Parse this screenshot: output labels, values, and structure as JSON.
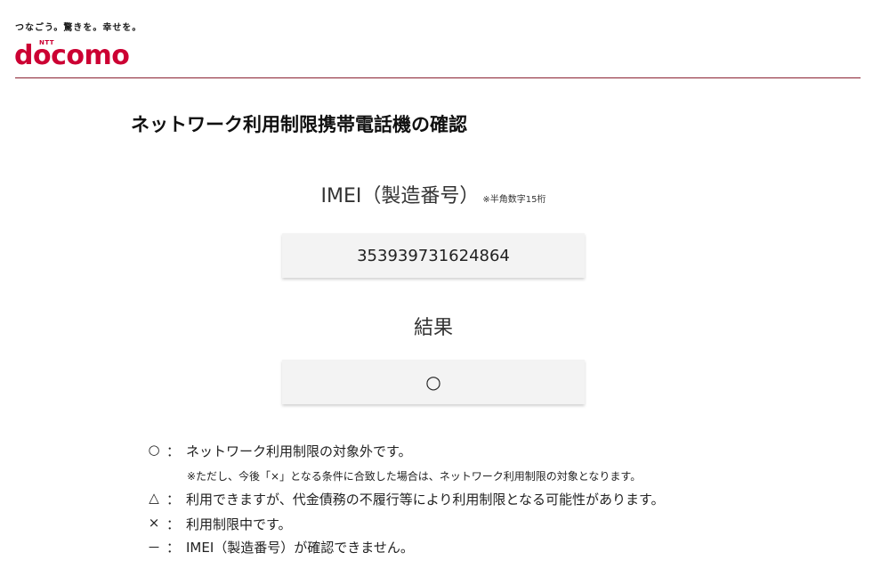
{
  "header": {
    "tagline": "つなごう。驚きを。幸せを。",
    "logo_ntt": "NTT",
    "logo_word": "docomo"
  },
  "page_title": "ネットワーク利用制限携帯電話機の確認",
  "imei": {
    "label": "IMEI（製造番号）",
    "note": "※半角数字15桁",
    "value": "353939731624864"
  },
  "result": {
    "label": "結果",
    "value": "○"
  },
  "legend": {
    "items": [
      {
        "symbol": "○",
        "colon": "：",
        "text": "ネットワーク利用制限の対象外です。"
      },
      {
        "symbol": "△",
        "colon": "：",
        "text": "利用できますが、代金債務の不履行等により利用制限となる可能性があります。"
      },
      {
        "symbol": "×",
        "colon": "：",
        "text": "利用制限中です。"
      },
      {
        "symbol": "－",
        "colon": "：",
        "text": "IMEI（製造番号）が確認できません。"
      }
    ],
    "sub_note": "※ただし、今後「×」となる条件に合致した場合は、ネットワーク利用制限の対象となります。"
  },
  "colors": {
    "brand": "#cc0033",
    "divider": "#8a2030"
  }
}
